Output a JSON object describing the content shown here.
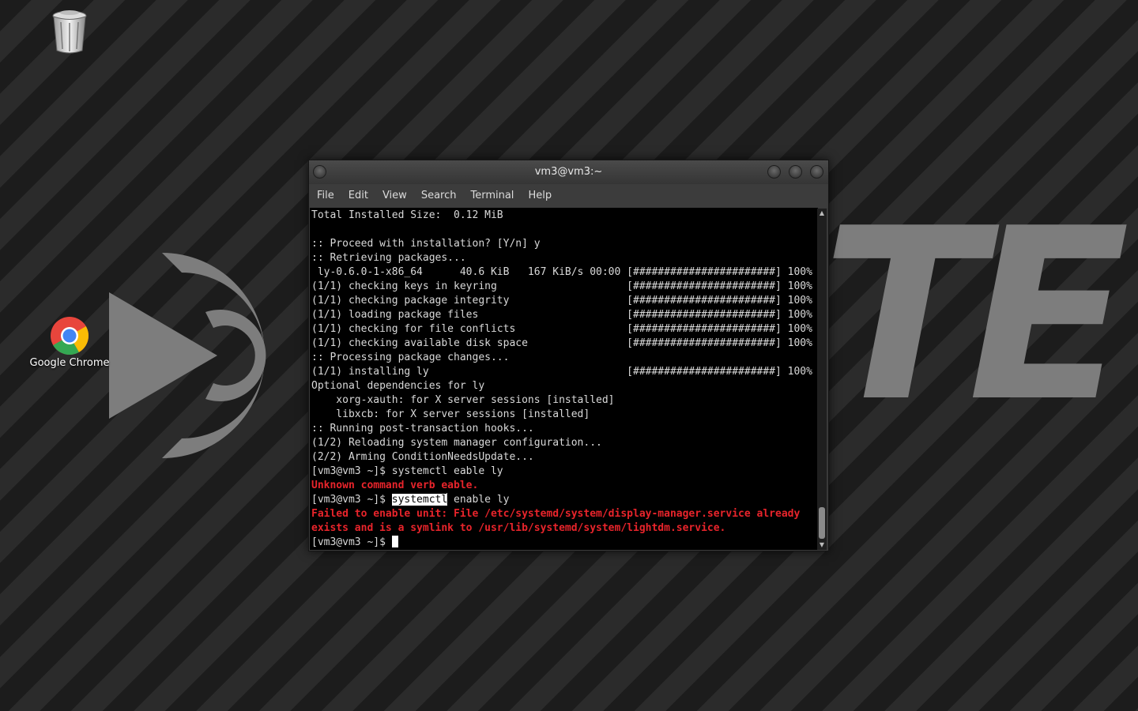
{
  "desktop": {
    "wallpaper_text": "TE",
    "icons": [
      {
        "label": "",
        "icon": "trash-icon"
      },
      {
        "label": "Google Chrome",
        "icon": "chrome-icon"
      }
    ]
  },
  "terminal": {
    "title": "vm3@vm3:~",
    "menu": [
      "File",
      "Edit",
      "View",
      "Search",
      "Terminal",
      "Help"
    ],
    "lines": [
      "Total Installed Size:  0.12 MiB",
      "",
      ":: Proceed with installation? [Y/n] y",
      ":: Retrieving packages...",
      " ly-0.6.0-1-x86_64      40.6 KiB   167 KiB/s 00:00 [#######################] 100%",
      "(1/1) checking keys in keyring                     [#######################] 100%",
      "(1/1) checking package integrity                   [#######################] 100%",
      "(1/1) loading package files                        [#######################] 100%",
      "(1/1) checking for file conflicts                  [#######################] 100%",
      "(1/1) checking available disk space                [#######################] 100%",
      ":: Processing package changes...",
      "(1/1) installing ly                                [#######################] 100%",
      "Optional dependencies for ly",
      "    xorg-xauth: for X server sessions [installed]",
      "    libxcb: for X server sessions [installed]",
      ":: Running post-transaction hooks...",
      "(1/2) Reloading system manager configuration...",
      "(2/2) Arming ConditionNeedsUpdate...",
      "[vm3@vm3 ~]$ systemctl eable ly",
      "Unknown command verb eable.",
      "",
      "Failed to enable unit: File /etc/systemd/system/display-manager.service already",
      "exists and is a symlink to /usr/lib/systemd/system/lightdm.service.",
      "[vm3@vm3 ~]$ "
    ],
    "error_lines": [
      19,
      21,
      22
    ],
    "selected_command": {
      "line": 20,
      "prompt": "[vm3@vm3 ~]$ ",
      "selected": "systemctl",
      "rest": " enable ly"
    },
    "cursor_line": 23,
    "scroll_position": 1.0
  },
  "colors": {
    "error_text": "#e8242b",
    "terminal_bg": "#000000",
    "terminal_fg": "#d9d9d9"
  }
}
